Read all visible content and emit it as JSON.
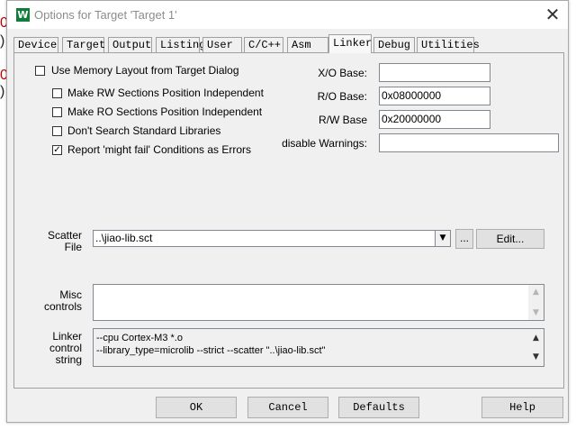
{
  "background": {
    "fragments": [
      "0",
      ")",
      "0",
      ")"
    ]
  },
  "window": {
    "title": "Options for Target 'Target 1'",
    "icon_glyph": "W",
    "close_glyph": "✕"
  },
  "tabs": [
    {
      "label": "Device"
    },
    {
      "label": "Target"
    },
    {
      "label": "Output"
    },
    {
      "label": "Listing"
    },
    {
      "label": "User"
    },
    {
      "label": "C/C++"
    },
    {
      "label": "Asm"
    },
    {
      "label": "Linker",
      "active": true
    },
    {
      "label": "Debug"
    },
    {
      "label": "Utilities"
    }
  ],
  "linker": {
    "options": [
      {
        "label": "Use Memory Layout from Target Dialog",
        "checked": false
      },
      {
        "label": "Make RW Sections Position Independent",
        "checked": false
      },
      {
        "label": "Make RO Sections Position Independent",
        "checked": false
      },
      {
        "label": "Don't Search Standard Libraries",
        "checked": false
      },
      {
        "label": "Report 'might fail' Conditions as Errors",
        "checked": true
      }
    ],
    "check_glyph": "✓",
    "xo_base": {
      "label": "X/O Base:",
      "value": ""
    },
    "ro_base": {
      "label": "R/O Base:",
      "value": "0x08000000"
    },
    "rw_base": {
      "label": "R/W Base",
      "value": "0x20000000"
    },
    "disable_warnings": {
      "label": "disable Warnings:",
      "value": ""
    },
    "scatter": {
      "label_line1": "Scatter",
      "label_line2": "File",
      "value": "..\\jiao-lib.sct",
      "browse_label": "...",
      "edit_label": "Edit...",
      "dropdown_glyph": "▼"
    },
    "misc": {
      "label_line1": "Misc",
      "label_line2": "controls",
      "value": ""
    },
    "control_string": {
      "label_line1": "Linker",
      "label_line2": "control",
      "label_line3": "string",
      "line1": "--cpu Cortex-M3 *.o",
      "line2": "--library_type=microlib --strict --scatter \"..\\jiao-lib.sct\""
    },
    "scroll_up_glyph": "▲",
    "scroll_down_glyph": "▼"
  },
  "buttons": {
    "ok": "OK",
    "cancel": "Cancel",
    "defaults": "Defaults",
    "help": "Help"
  }
}
